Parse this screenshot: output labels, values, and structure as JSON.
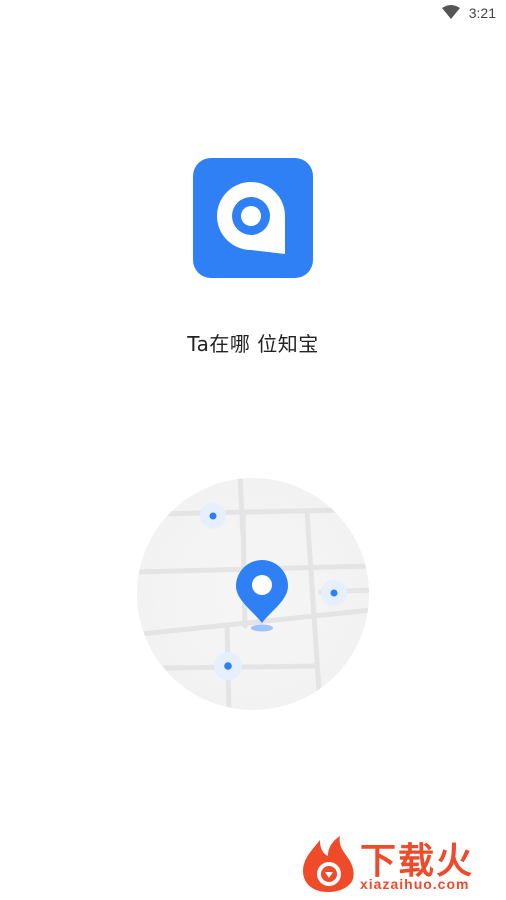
{
  "status_bar": {
    "time": "3:21",
    "wifi_icon": "wifi-icon"
  },
  "app": {
    "name": "Ta在哪 位知宝",
    "icon": "location-chat-icon",
    "brand_color": "#2f7ff5"
  },
  "illustration": {
    "icon": "map-location-pin-icon"
  },
  "watermark": {
    "title": "下载火",
    "url": "xiazaihuo.com",
    "color": "#ef4a2a",
    "icon": "flame-logo-icon"
  }
}
